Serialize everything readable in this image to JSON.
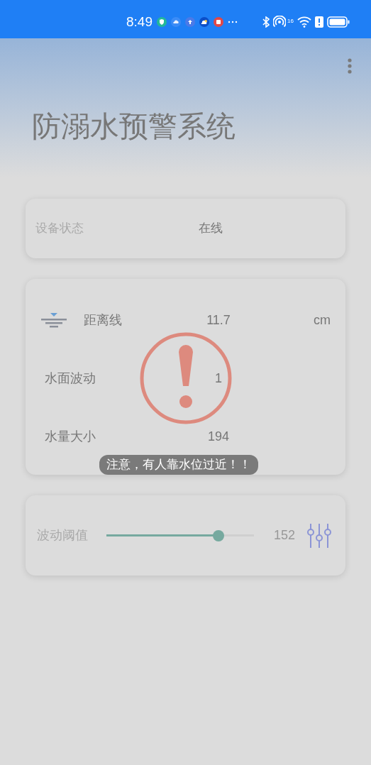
{
  "status_bar": {
    "time": "8:49",
    "network_label": "16"
  },
  "app": {
    "title": "防溺水预警系统"
  },
  "device": {
    "label": "设备状态",
    "value": "在线"
  },
  "readings": [
    {
      "kind": "icon",
      "label": "距离线",
      "value": "11.7",
      "unit": "cm"
    },
    {
      "kind": "plain",
      "label": "水面波动",
      "value": "1"
    },
    {
      "kind": "plain",
      "label": "水量大小",
      "value": "194"
    }
  ],
  "threshold": {
    "label": "波动阈值",
    "level": 0.76,
    "value": "152"
  },
  "alert": {
    "message": "注意，有人靠水位过近！！"
  }
}
